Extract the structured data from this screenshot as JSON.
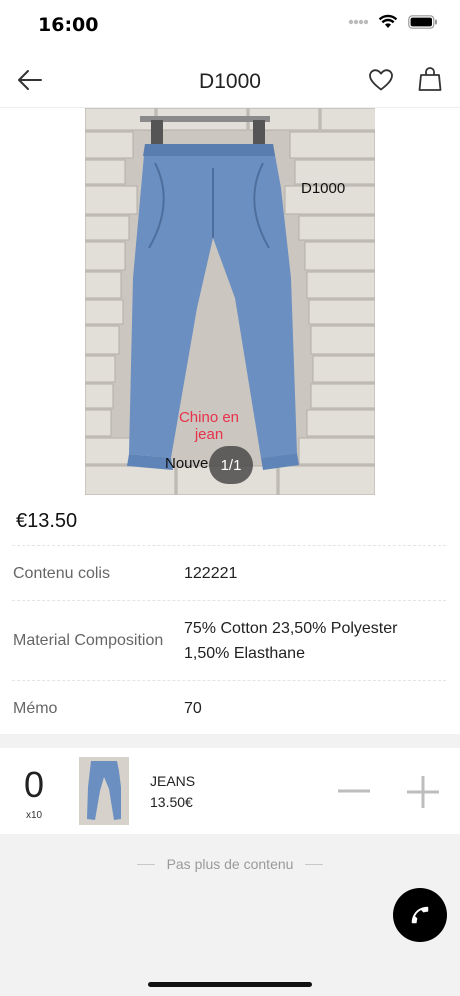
{
  "status_bar": {
    "time": "16:00",
    "icons": [
      "signal-dots-icon",
      "wifi-icon",
      "battery-icon"
    ]
  },
  "header": {
    "title": "D1000",
    "icons": [
      "back-arrow-icon",
      "heart-icon",
      "shopping-bag-icon"
    ]
  },
  "product": {
    "image_overlay": {
      "code": "D1000",
      "pink_label": "Chino en jean",
      "partial_label": "Nouve",
      "pink_color": "#e8324b"
    },
    "pager": "1/1",
    "price": "€13.50",
    "details": [
      {
        "label": "Contenu colis",
        "value": "122221"
      },
      {
        "label": "Material Composition",
        "value": "75% Cotton 23,50% Polyester 1,50% Elasthane"
      },
      {
        "label": "Mémo",
        "value": "70"
      }
    ]
  },
  "cart_row": {
    "quantity": "0",
    "multiplier": "x10",
    "name": "JEANS",
    "price": "13.50€",
    "icons": [
      "minus-icon",
      "plus-icon"
    ]
  },
  "footer": {
    "end_text": "Pas plus de contenu",
    "call_icon": "phone-icon",
    "call_button_color": "#000000"
  }
}
